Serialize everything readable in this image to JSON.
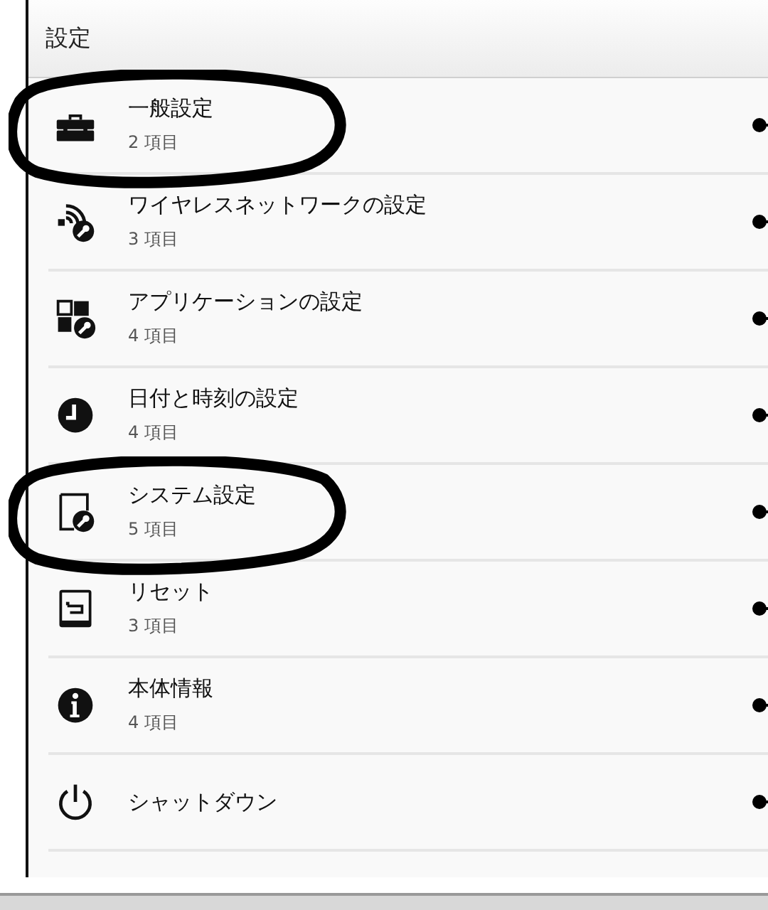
{
  "header": {
    "title": "設定"
  },
  "items": [
    {
      "kind": "toolbox",
      "title": "一般設定",
      "count": "2 項目",
      "circled": true
    },
    {
      "kind": "wireless",
      "title": "ワイヤレスネットワークの設定",
      "count": "3 項目",
      "circled": false
    },
    {
      "kind": "apps",
      "title": "アプリケーションの設定",
      "count": "4 項目",
      "circled": false
    },
    {
      "kind": "clock",
      "title": "日付と時刻の設定",
      "count": "4 項目",
      "circled": false
    },
    {
      "kind": "system",
      "title": "システム設定",
      "count": "5 項目",
      "circled": true
    },
    {
      "kind": "reset",
      "title": "リセット",
      "count": "3 項目",
      "circled": false
    },
    {
      "kind": "info",
      "title": "本体情報",
      "count": "4 項目",
      "circled": false
    },
    {
      "kind": "power",
      "title": "シャットダウン",
      "circled": false
    }
  ]
}
